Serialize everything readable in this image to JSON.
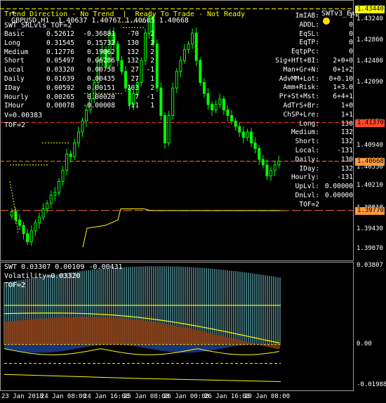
{
  "header": {
    "symbol_line": "GBPUSD,H1  1.40637 1.40767 1.40605 1.40668",
    "expert_badge": "SWTv3_Exp",
    "status_line": "Trend Direction - No Trend  |  Ready To Trade - Not Ready",
    "indicator_name": "SWT_SRLvls_TOF=2"
  },
  "left_table": [
    {
      "label": "Basic",
      "v1": "0.52612",
      "v2": "-0.36881",
      "v3": "-70",
      "v4": "2"
    },
    {
      "label": "Long",
      "v1": "0.31545",
      "v2": "0.15732",
      "v3": "130",
      "v4": "2"
    },
    {
      "label": "Medium",
      "v1": "0.12776",
      "v2": "0.19062",
      "v3": "132",
      "v4": "2"
    },
    {
      "label": "Short",
      "v1": "0.05497",
      "v2": "0.06286",
      "v3": "132",
      "v4": "2"
    },
    {
      "label": "Local",
      "v1": "0.03320",
      "v2": "0.00758",
      "v3": "27",
      "v4": "-1"
    },
    {
      "label": "Daily",
      "v1": "0.01639",
      "v2": "0.00435",
      "v3": "27",
      "v4": "1"
    },
    {
      "label": "IDay",
      "v1": "0.00592",
      "v2": "0.00151",
      "v3": "103",
      "v4": "2"
    },
    {
      "label": "Hourly",
      "v1": "0.00265",
      "v2": "0.00020",
      "v3": "7",
      "v4": "-1"
    },
    {
      "label": "IHour",
      "v1": "0.00078",
      "v2": "-0.00008",
      "v3": "-11",
      "v4": "1"
    }
  ],
  "v_line": "V=0.00383",
  "tof_line": "TOF=2",
  "right_table": [
    {
      "label": "ImIAB:",
      "value": "1"
    },
    {
      "label": "ADDL:",
      "value": "0"
    },
    {
      "label": "EqSL:",
      "value": "0"
    },
    {
      "label": "EqTP:",
      "value": "0"
    },
    {
      "label": "EqtpPc:",
      "value": "0"
    },
    {
      "label": "Sig+Hft+BI:",
      "value": "2+0+0"
    },
    {
      "label": "Man+Gr+N:",
      "value": "0+1+2"
    },
    {
      "label": "AdvMM+Lot:",
      "value": "0+0.10"
    },
    {
      "label": "Amm+Risk:",
      "value": "1+3.0"
    },
    {
      "label": "Pr+St+Mst:",
      "value": "6+4+1"
    },
    {
      "label": "AdTrS+Br:",
      "value": "1+0"
    },
    {
      "label": "ChSP+Lre:",
      "value": "1+1"
    },
    {
      "label": "Long:",
      "value": "130"
    },
    {
      "label": "Medium:",
      "value": "132"
    },
    {
      "label": "Short:",
      "value": "132"
    },
    {
      "label": "Local:",
      "value": "-131"
    },
    {
      "label": "Daily:",
      "value": "130"
    },
    {
      "label": "IDay:",
      "value": "132"
    },
    {
      "label": "Hourly:",
      "value": "-131"
    },
    {
      "label": "UpLvl:",
      "value": "0.00000"
    },
    {
      "label": "DnLvl:",
      "value": "0.00000"
    },
    {
      "label": "TOF=2",
      "value": ""
    }
  ],
  "price_axis": [
    "1.43440",
    "1.43240",
    "1.42860",
    "1.42480",
    "1.42090",
    "1.41370",
    "1.41320",
    "1.40940",
    "1.40668",
    "1.40550",
    "1.40210",
    "1.39770",
    "1.39810",
    "1.39430",
    "1.39070"
  ],
  "price_tags": [
    {
      "text": "1.43440",
      "color": "#ffff00"
    },
    {
      "text": "1.41370",
      "color": "#ff4a2a"
    },
    {
      "text": "1.40668",
      "color": "#ff9a3a"
    },
    {
      "text": "1.39770",
      "color": "#ff9a3a"
    }
  ],
  "sub": {
    "header": "SWT 0.03307 0.00109 -0.00431",
    "volatility": "Volatility=0.03320",
    "tof": "TOF=2",
    "axis": [
      "0.03807",
      "0.00",
      "-0.01988"
    ]
  },
  "time_axis": [
    "23 Jan 2018",
    "24 Jan 08:00",
    "24 Jan 16:00",
    "25 Jan 08:00",
    "26 Jan 00:00",
    "26 Jan 16:00",
    "26 Jan 08:00",
    "29 Jan 08:00"
  ],
  "colors": {
    "bull": "#00ff00",
    "bear": "#00ff00",
    "yellow": "#ffff00",
    "red": "#ff3b2a",
    "cyan": "#7ad3e0",
    "orange_fill": "#8b3a10"
  },
  "chart_data": {
    "type": "candlestick",
    "symbol": "GBPUSD",
    "timeframe": "H1",
    "ohlc_last": {
      "open": 1.40637,
      "high": 1.40767,
      "low": 1.40605,
      "close": 1.40668
    },
    "y_range": [
      1.389,
      1.4355
    ],
    "levels": [
      1.4344,
      1.4137,
      1.40668,
      1.3977
    ],
    "closes": [
      1.3975,
      1.396,
      1.395,
      1.3935,
      1.392,
      1.394,
      1.3955,
      1.3965,
      1.398,
      1.399,
      1.4005,
      1.401,
      1.403,
      1.405,
      1.408,
      1.4075,
      1.41,
      1.412,
      1.414,
      1.416,
      1.418,
      1.421,
      1.425,
      1.427,
      1.424,
      1.43,
      1.428,
      1.425,
      1.423,
      1.42,
      1.417,
      1.419,
      1.421,
      1.425,
      1.43,
      1.433,
      1.428,
      1.42,
      1.415,
      1.41,
      1.415,
      1.42,
      1.423,
      1.425,
      1.427,
      1.428,
      1.43,
      1.425,
      1.421,
      1.419,
      1.417,
      1.416,
      1.417,
      1.418,
      1.416,
      1.415,
      1.414,
      1.413,
      1.412,
      1.411,
      1.412,
      1.41,
      1.409,
      1.407,
      1.406,
      1.404,
      1.405,
      1.406,
      1.4067
    ],
    "sub_range": [
      -0.01988,
      0.03807
    ]
  }
}
